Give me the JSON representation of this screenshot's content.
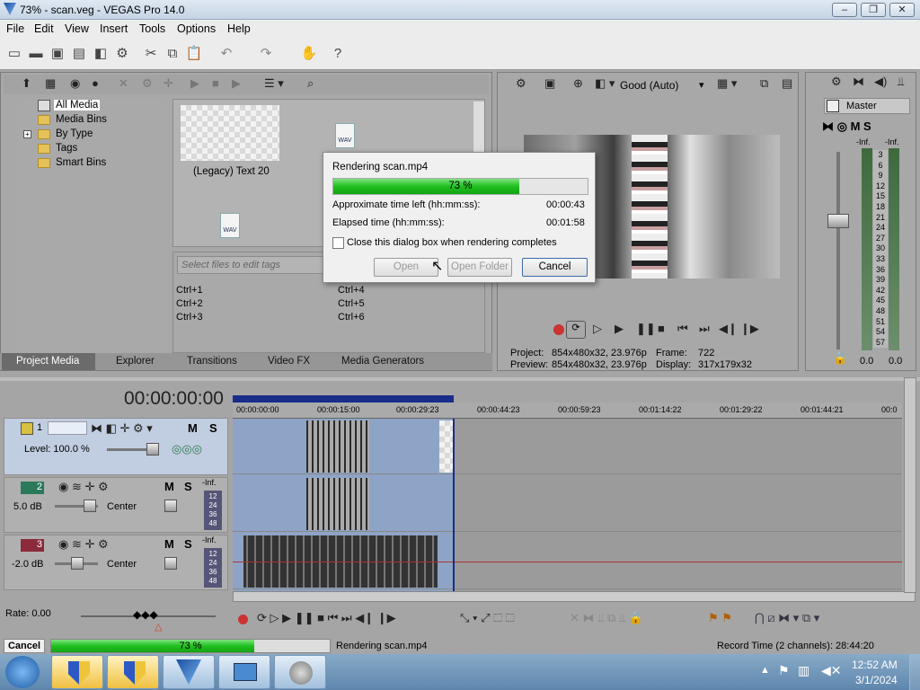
{
  "window": {
    "title": "73% - scan.veg - VEGAS Pro 14.0"
  },
  "menu": [
    "File",
    "Edit",
    "View",
    "Insert",
    "Tools",
    "Options",
    "Help"
  ],
  "media": {
    "tree": [
      "All Media",
      "Media Bins",
      "By Type",
      "Tags",
      "Smart Bins"
    ],
    "items": [
      {
        "label": "(Legacy) Text 20"
      },
      {
        "label": "WAV"
      },
      {
        "label": "WAV"
      }
    ],
    "tag_placeholder": "Select files to edit tags",
    "shortcuts": [
      "Ctrl+1",
      "Ctrl+4",
      "Ctrl+2",
      "Ctrl+5",
      "Ctrl+3",
      "Ctrl+6"
    ]
  },
  "tabs": [
    "Project Media",
    "Explorer",
    "Transitions",
    "Video FX",
    "Media Generators"
  ],
  "preview": {
    "quality": "Good (Auto)",
    "project_label": "Project:",
    "project_value": "854x480x32, 23.976p",
    "preview_label": "Preview:",
    "preview_value": "854x480x32, 23.976p",
    "frame_label": "Frame:",
    "frame_value": "722",
    "display_label": "Display:",
    "display_value": "317x179x32"
  },
  "master": {
    "label": "Master",
    "inf": "-Inf.",
    "scale": [
      "3",
      "6",
      "9",
      "12",
      "15",
      "18",
      "21",
      "24",
      "27",
      "30",
      "33",
      "36",
      "39",
      "42",
      "45",
      "48",
      "51",
      "54",
      "57"
    ],
    "left_value": "0.0",
    "right_value": "0.0"
  },
  "timeline": {
    "time": "00:00:00:00",
    "ruler": [
      "00:00:00:00",
      "00:00:15:00",
      "00:00:29:23",
      "00:00:44:23",
      "00:00:59:23",
      "00:01:14:22",
      "00:01:29:22",
      "00:01:44:21",
      "00:0"
    ],
    "tracks": [
      {
        "num": "1",
        "level": "Level: 100.0 %",
        "m": "M",
        "s": "S"
      },
      {
        "num": "2",
        "db": "5.0 dB",
        "pan": "Center",
        "m": "M",
        "s": "S",
        "inf": "-Inf.",
        "scale": [
          "12",
          "24",
          "36",
          "48"
        ]
      },
      {
        "num": "3",
        "db": "-2.0 dB",
        "pan": "Center",
        "m": "M",
        "s": "S",
        "inf": "-Inf.",
        "scale": [
          "12",
          "24",
          "36",
          "48"
        ]
      }
    ],
    "rate": "Rate: 0.00"
  },
  "dialog": {
    "title": "Rendering scan.mp4",
    "percent": "73 %",
    "progress": 0.73,
    "time_left_label": "Approximate time left (hh:mm:ss):",
    "time_left_value": "00:00:43",
    "elapsed_label": "Elapsed time (hh:mm:ss):",
    "elapsed_value": "00:01:58",
    "close_checkbox_label": "Close this dialog box when rendering completes",
    "open_label": "Open",
    "open_folder_label": "Open Folder",
    "cancel_label": "Cancel"
  },
  "status": {
    "cancel_label": "Cancel",
    "percent": "73 %",
    "progress": 0.73,
    "rendering_text": "Rendering scan.mp4",
    "record_time": "Record Time (2 channels): 28:44:20"
  },
  "taskbar": {
    "time": "12:52 AM",
    "date": "3/1/2024"
  },
  "colors": {
    "progress_green": "#20c020",
    "playhead_blue": "#1a2c8a",
    "taskbar": "#5e86ad"
  }
}
